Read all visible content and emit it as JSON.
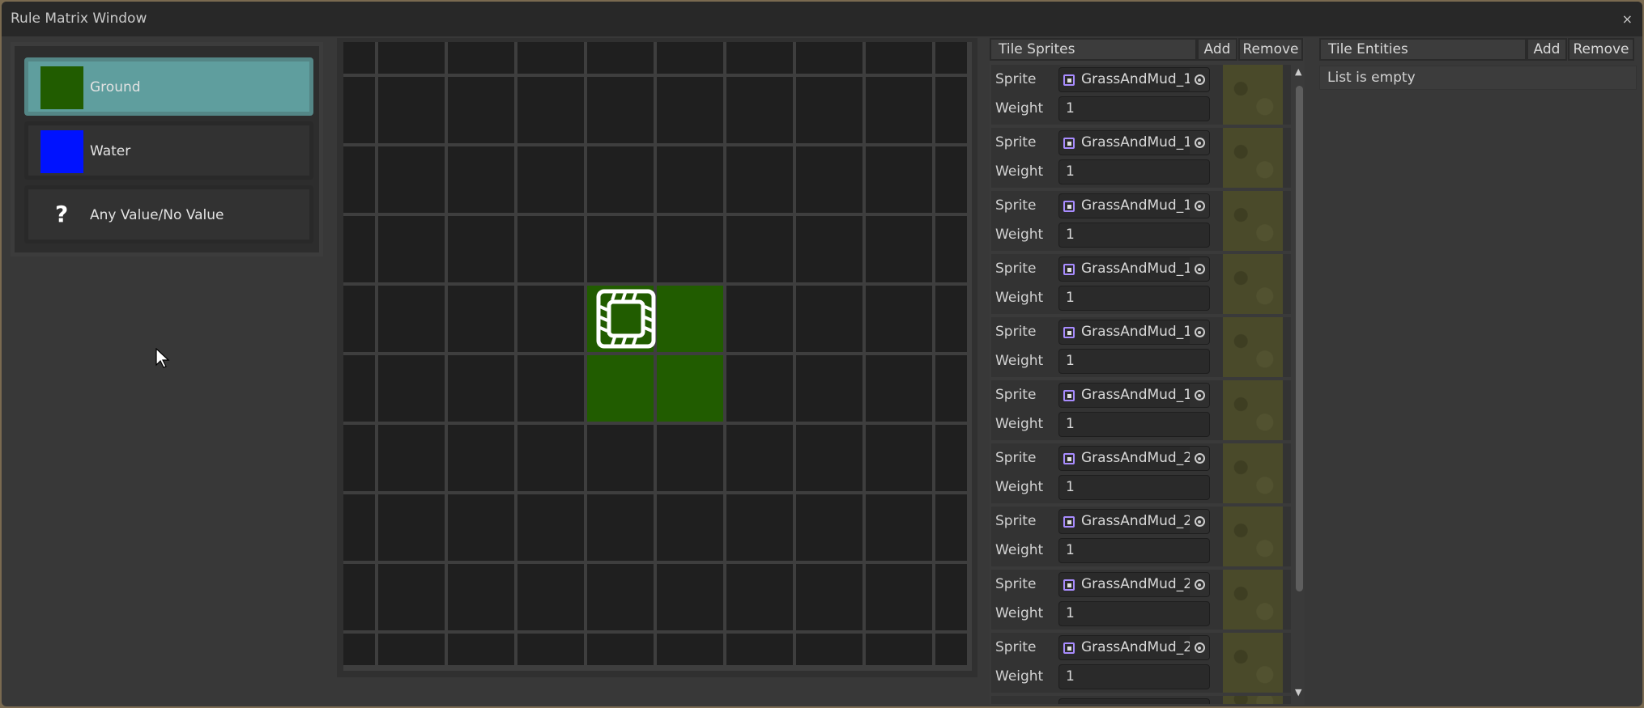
{
  "window": {
    "title": "Rule Matrix Window",
    "close": "×"
  },
  "values": [
    {
      "label": "Ground",
      "color": "#215c00",
      "selected": true
    },
    {
      "label": "Water",
      "color": "#0012ff",
      "selected": false
    },
    {
      "label": "Any Value/No Value",
      "icon": "?",
      "selected": false
    }
  ],
  "matrix": {
    "rows": 10,
    "cols": 10,
    "filled_color": "#215c00",
    "filled_cells": [
      [
        4,
        4
      ],
      [
        4,
        5
      ],
      [
        5,
        4
      ],
      [
        5,
        5
      ]
    ],
    "center_icon": "tile-center-icon"
  },
  "tile_sprites": {
    "title": "Tile Sprites",
    "add": "Add",
    "remove": "Remove",
    "sprite_label": "Sprite",
    "weight_label": "Weight",
    "items": [
      {
        "sprite": "GrassAndMud_1",
        "weight": "1"
      },
      {
        "sprite": "GrassAndMud_1",
        "weight": "1"
      },
      {
        "sprite": "GrassAndMud_1",
        "weight": "1"
      },
      {
        "sprite": "GrassAndMud_1",
        "weight": "1"
      },
      {
        "sprite": "GrassAndMud_1",
        "weight": "1"
      },
      {
        "sprite": "GrassAndMud_1",
        "weight": "1"
      },
      {
        "sprite": "GrassAndMud_2",
        "weight": "1"
      },
      {
        "sprite": "GrassAndMud_2",
        "weight": "1"
      },
      {
        "sprite": "GrassAndMud_2",
        "weight": "1"
      },
      {
        "sprite": "GrassAndMud_2",
        "weight": "1"
      }
    ]
  },
  "tile_entities": {
    "title": "Tile Entities",
    "add": "Add",
    "remove": "Remove",
    "empty_text": "List is empty"
  }
}
